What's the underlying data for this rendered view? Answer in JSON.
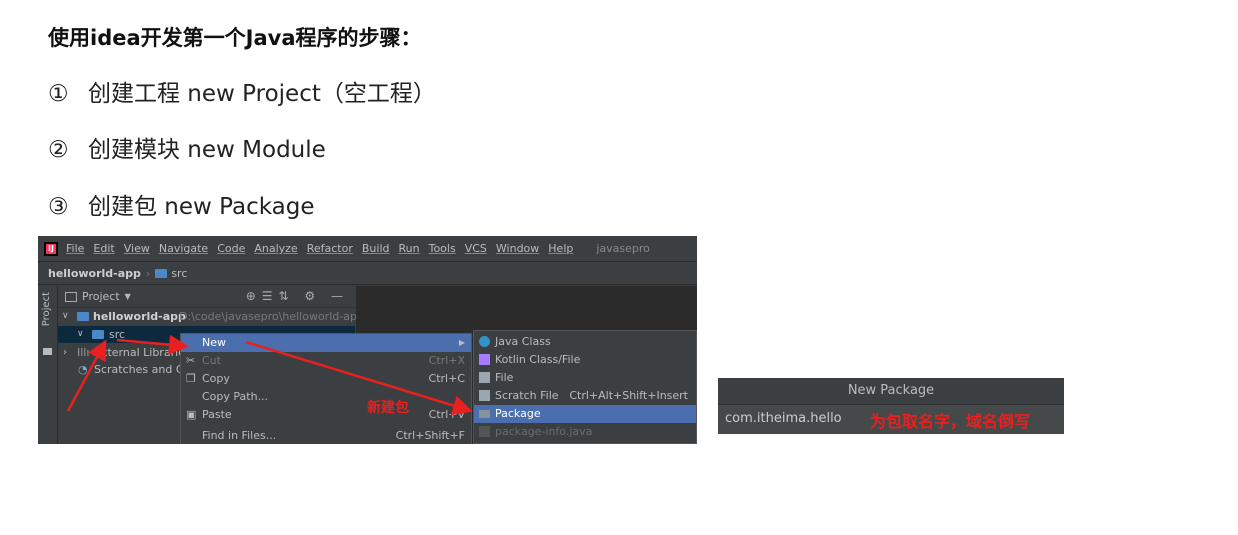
{
  "heading": "使用idea开发第一个Java程序的步骤：",
  "steps": [
    {
      "num": "①",
      "text": "创建工程 new Project（空工程）"
    },
    {
      "num": "②",
      "text": "创建模块 new Module"
    },
    {
      "num": "③",
      "text": "创建包 new Package"
    }
  ],
  "ide": {
    "menus": [
      "File",
      "Edit",
      "View",
      "Navigate",
      "Code",
      "Analyze",
      "Refactor",
      "Build",
      "Run",
      "Tools",
      "VCS",
      "Window",
      "Help"
    ],
    "project_name": "javasepro",
    "breadcrumb": {
      "project": "helloworld-app",
      "folder": "src"
    },
    "side_label": "Project",
    "panel_title": "Project",
    "tree": [
      {
        "label": "helloworld-app",
        "path": "D:\\code\\javasepro\\helloworld-app"
      },
      {
        "label": "src"
      },
      {
        "label": "External Libraries"
      },
      {
        "label": "Scratches and Co"
      }
    ],
    "context_menu": [
      {
        "label": "New",
        "shortcut": ""
      },
      {
        "label": "Cut",
        "shortcut": "Ctrl+X"
      },
      {
        "label": "Copy",
        "shortcut": "Ctrl+C"
      },
      {
        "label": "Copy Path...",
        "shortcut": ""
      },
      {
        "label": "Paste",
        "shortcut": "Ctrl+V"
      },
      {
        "label": "Find in Files...",
        "shortcut": "Ctrl+Shift+F"
      }
    ],
    "submenu": [
      {
        "label": "Java Class",
        "shortcut": ""
      },
      {
        "label": "Kotlin Class/File",
        "shortcut": ""
      },
      {
        "label": "File",
        "shortcut": ""
      },
      {
        "label": "Scratch File",
        "shortcut": "Ctrl+Alt+Shift+Insert"
      },
      {
        "label": "Package",
        "shortcut": ""
      },
      {
        "label": "package-info.java",
        "shortcut": ""
      }
    ],
    "annotation": "新建包",
    "colors": {
      "highlight": "#4b6eaf",
      "annotation": "#e8201f"
    }
  },
  "dialog": {
    "title": "New Package",
    "value": "com.itheima.hello",
    "annotation": "为包取名字，域名倒写"
  }
}
